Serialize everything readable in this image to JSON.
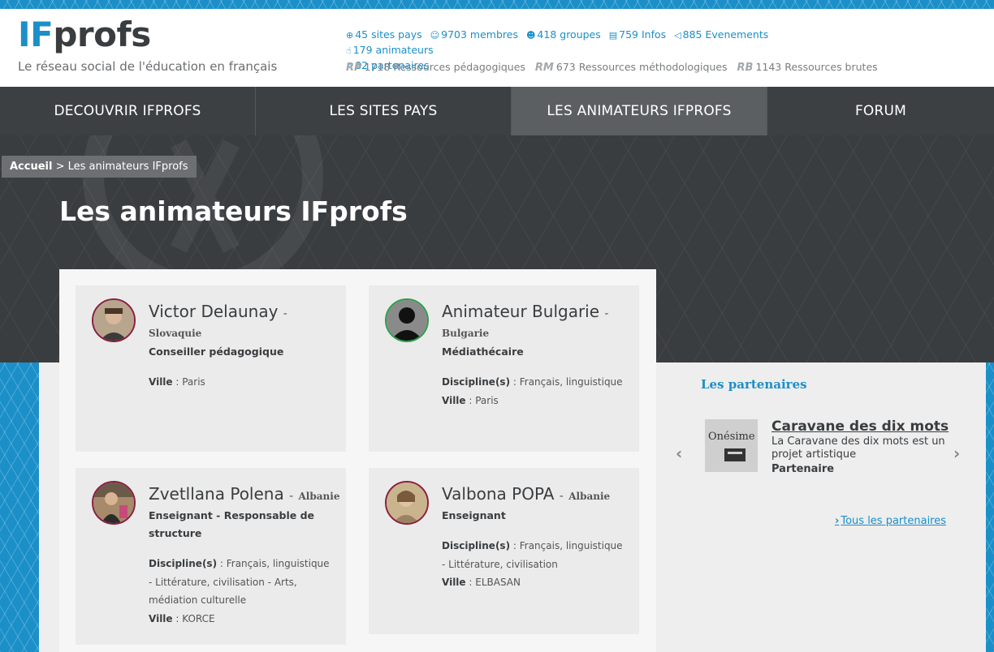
{
  "header": {
    "logo_if": "IF",
    "logo_profs": "profs",
    "tagline": "Le réseau social de l'éducation en français",
    "stats": [
      {
        "icon": "globe-icon",
        "label": "45 sites pays"
      },
      {
        "icon": "user-icon",
        "label": "9703 membres"
      },
      {
        "icon": "group-icon",
        "label": "418 groupes"
      },
      {
        "icon": "chat-icon",
        "label": "759 Infos"
      },
      {
        "icon": "megaphone-icon",
        "label": "885 Evenements"
      },
      {
        "icon": "thumbs-up-icon",
        "label": "179 animateurs"
      },
      {
        "icon": "handshake-icon",
        "label": "82 partenaires"
      }
    ],
    "resources": [
      {
        "tag": "RP",
        "label": "1718 Ressources pédagogiques"
      },
      {
        "tag": "RM",
        "label": "673 Ressources méthodologiques"
      },
      {
        "tag": "RB",
        "label": "1143 Ressources brutes"
      }
    ]
  },
  "nav": [
    {
      "label": "DECOUVRIR IFPROFS",
      "active": false
    },
    {
      "label": "LES SITES PAYS",
      "active": false
    },
    {
      "label": "LES ANIMATEURS IFPROFS",
      "active": true
    },
    {
      "label": "FORUM",
      "active": false
    }
  ],
  "breadcrumb": {
    "home": "Accueil",
    "separator": " > ",
    "current": "Les animateurs IFprofs"
  },
  "page_title": "Les animateurs IFprofs",
  "animators": [
    {
      "name": "Victor Delaunay",
      "country": "Slovaquie",
      "role": "Conseiller pédagogique",
      "fields": [
        {
          "label": "Ville",
          "value": "Paris"
        }
      ]
    },
    {
      "name": "Animateur Bulgarie",
      "country": "Bulgarie",
      "role": "Médiathécaire",
      "fields": [
        {
          "label": "Discipline(s)",
          "value": "Français, linguistique"
        },
        {
          "label": "Ville",
          "value": "Paris"
        }
      ]
    },
    {
      "name": "Zvetllana Polena",
      "country": "Albanie",
      "role": "Enseignant - Responsable de structure",
      "fields": [
        {
          "label": "Discipline(s)",
          "value": "Français, linguistique - Littérature, civilisation - Arts, médiation culturelle"
        },
        {
          "label": "Ville",
          "value": "KORCE"
        }
      ]
    },
    {
      "name": "Valbona POPA",
      "country": "Albanie",
      "role": "Enseignant",
      "fields": [
        {
          "label": "Discipline(s)",
          "value": "Français, linguistique - Littérature, civilisation"
        },
        {
          "label": "Ville",
          "value": "ELBASAN"
        }
      ]
    }
  ],
  "partners": {
    "title": "Les partenaires",
    "item": {
      "image_text": "Onésime",
      "name": "Caravane des dix mots",
      "description": "La Caravane des dix mots est un projet artistique",
      "type": "Partenaire"
    },
    "all_link": "Tous les partenaires"
  },
  "colors": {
    "brand_blue": "#1b8fc8",
    "dark": "#3a3d40",
    "nav_active": "#5c5f62",
    "avatar_border": "#8b1e3f"
  }
}
